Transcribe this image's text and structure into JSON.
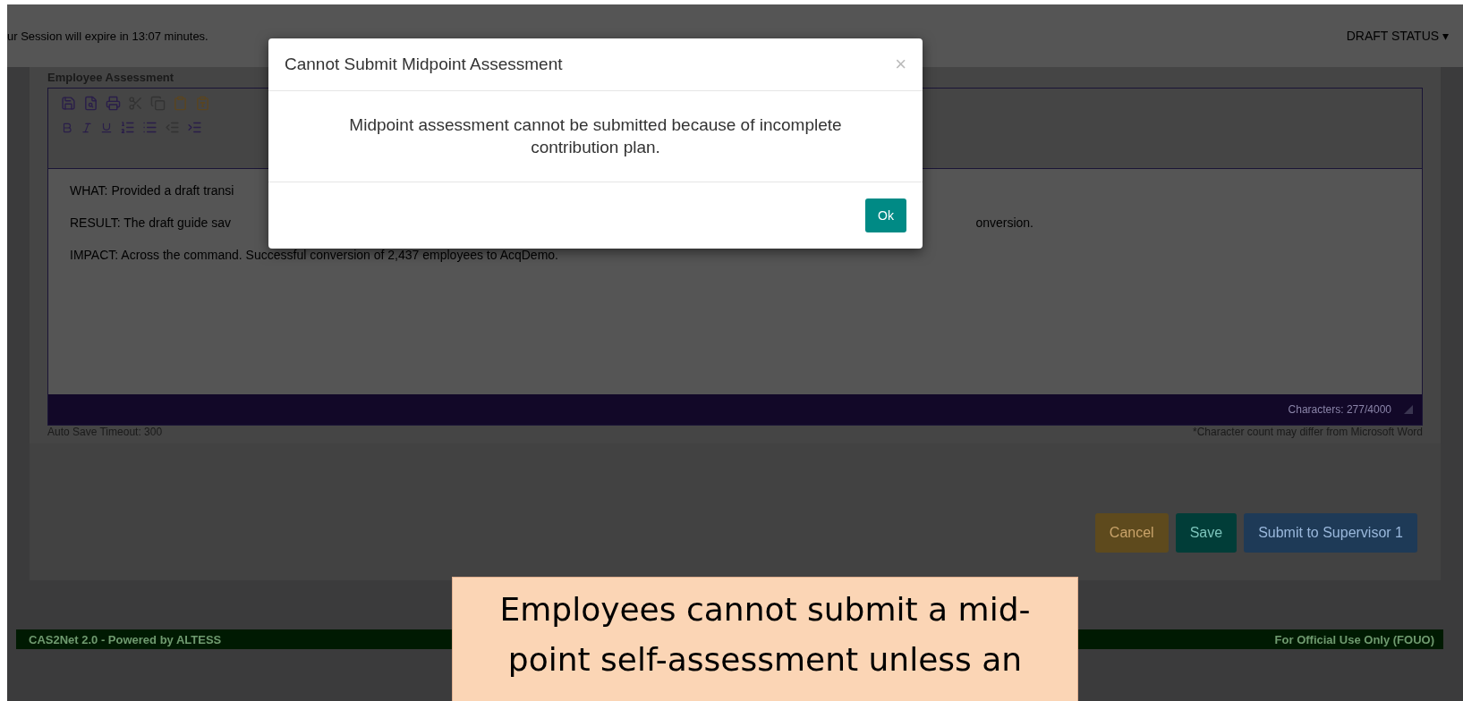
{
  "session_notice": "ur Session will expire in 13:07 minutes.",
  "status_menu": {
    "label": "DRAFT STATUS",
    "caret": "▾"
  },
  "editor": {
    "label": "Employee Assessment",
    "paragraphs": [
      "WHAT: Provided a draft transi",
      "RESULT:   The draft guide sav",
      "IMPACT:  Across the command. Successful conversion of 2,437 employees to AcqDemo."
    ],
    "paragraph_tail": "onversion.",
    "char_count": "Characters: 277/4000"
  },
  "auto_save": "Auto Save Timeout: 300",
  "count_note": "*Character count may differ from Microsoft Word",
  "actions": [
    {
      "label": "Cancel",
      "kind": "warning"
    },
    {
      "label": "Save",
      "kind": "success"
    },
    {
      "label": "Submit to Supervisor 1",
      "kind": "primary"
    }
  ],
  "footer": {
    "left": "CAS2Net 2.0 - Powered by ALTESS",
    "right": "For Official Use Only (FOUO)"
  },
  "modal": {
    "title": "Cannot Submit Midpoint Assessment",
    "close": "×",
    "message": "Midpoint assessment cannot be submitted because of incomplete contribution plan.",
    "button": "Ok"
  },
  "callout": "Employees cannot submit a mid-point self-assessment unless an"
}
